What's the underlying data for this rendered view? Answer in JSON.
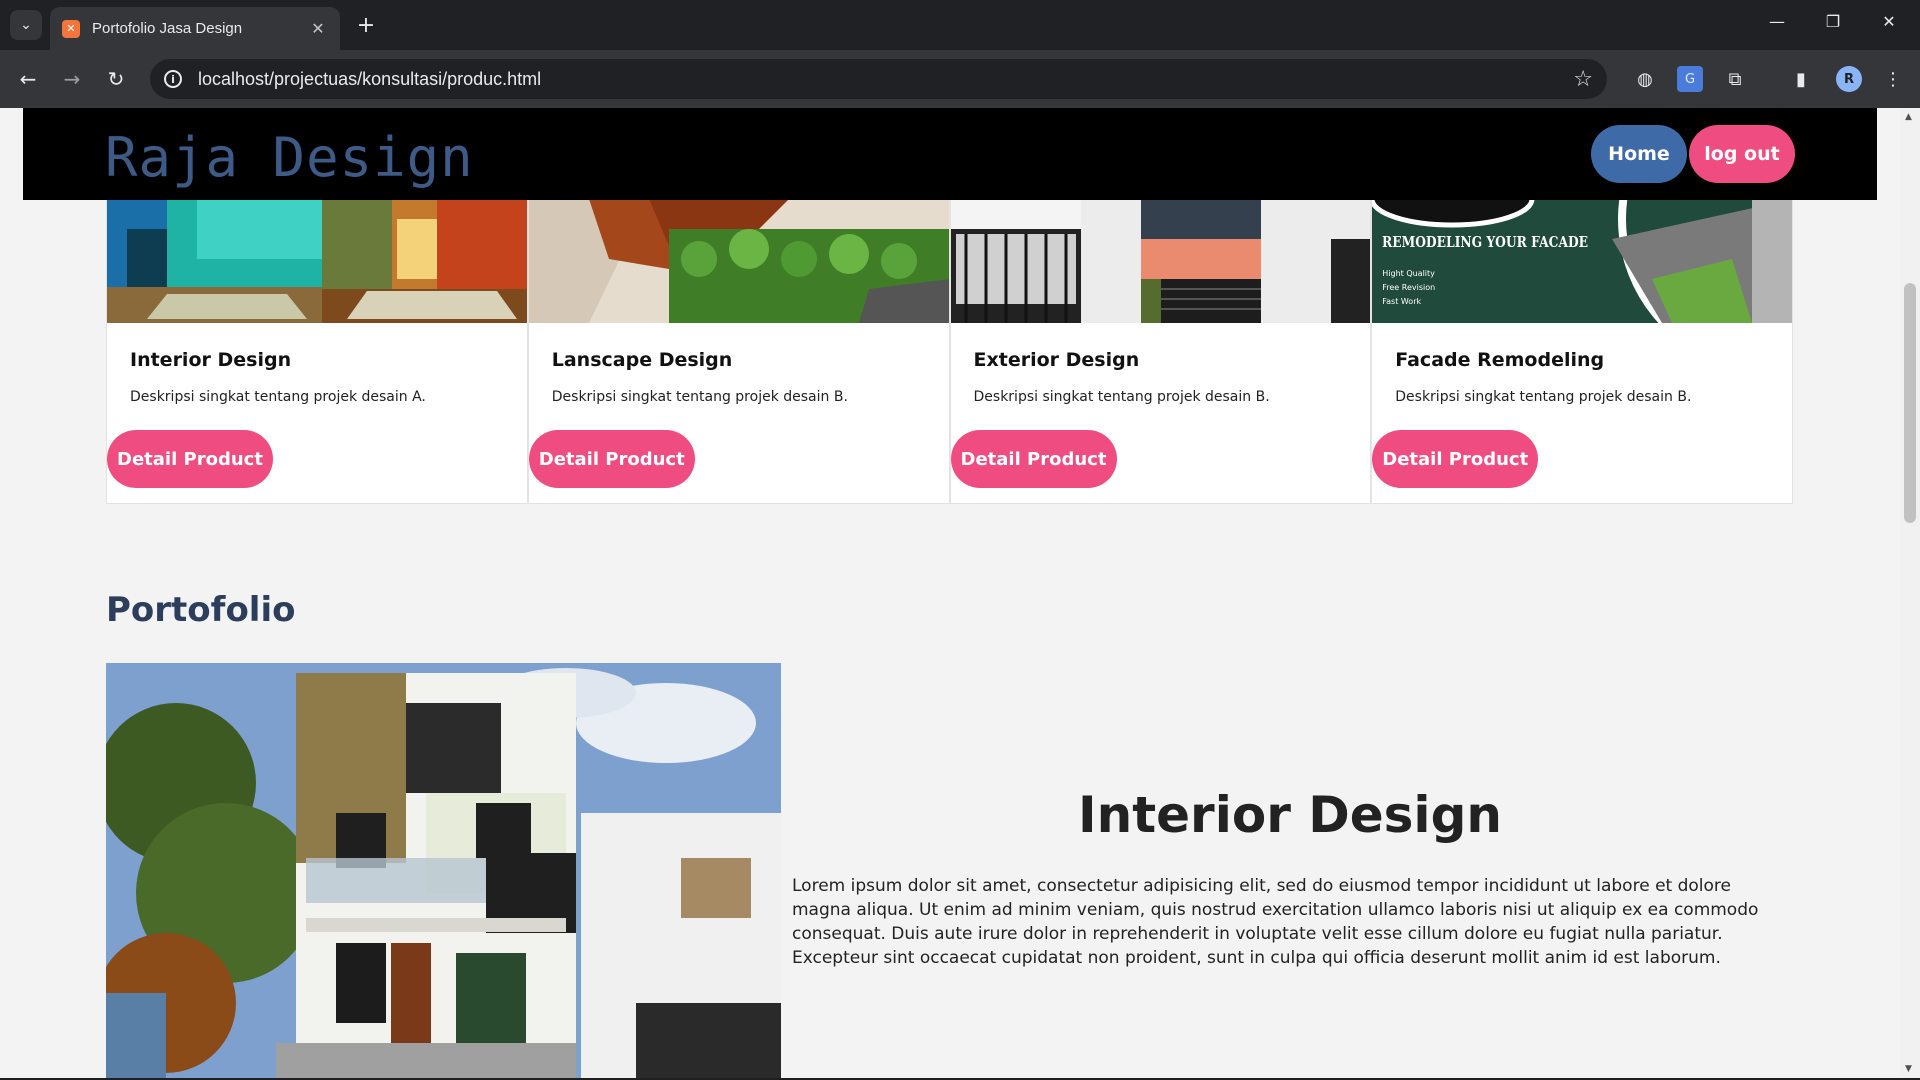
{
  "browser": {
    "tab_title": "Portofolio Jasa Design",
    "url": "localhost/projectuas/konsultasi/produc.html",
    "profile_initial": "R"
  },
  "header": {
    "brand": "Raja Design",
    "home_label": "Home",
    "logout_label": "log out"
  },
  "cards": [
    {
      "title": "Interior Design",
      "desc": "Deskripsi singkat tentang projek desain A.",
      "button": "Detail Product"
    },
    {
      "title": "Lanscape Design",
      "desc": "Deskripsi singkat tentang projek desain B.",
      "button": "Detail Product"
    },
    {
      "title": "Exterior Design",
      "desc": "Deskripsi singkat tentang projek desain B.",
      "button": "Detail Product"
    },
    {
      "title": "Facade Remodeling",
      "desc": "Deskripsi singkat tentang projek desain B.",
      "button": "Detail Product"
    }
  ],
  "facade_banner": {
    "headline": "REMODELING YOUR FACADE",
    "features": [
      "Hight Quality",
      "Free Revision",
      "Fast Work"
    ]
  },
  "portfolio": {
    "section_title": "Portofolio",
    "heading": "Interior Design",
    "body": "Lorem ipsum dolor sit amet, consectetur adipisicing elit, sed do eiusmod tempor incididunt ut labore et dolore magna aliqua. Ut enim ad minim veniam, quis nostrud exercitation ullamco laboris nisi ut aliquip ex ea commodo consequat. Duis aute irure dolor in reprehenderit in voluptate velit esse cillum dolore eu fugiat nulla pariatur. Excepteur sint occaecat cupidatat non proident, sunt in culpa qui officia deserunt mollit anim id est laborum."
  },
  "colors": {
    "brand_blue": "#3d5b86",
    "home_button": "#3f6aa8",
    "accent_pink": "#ef4d82"
  }
}
